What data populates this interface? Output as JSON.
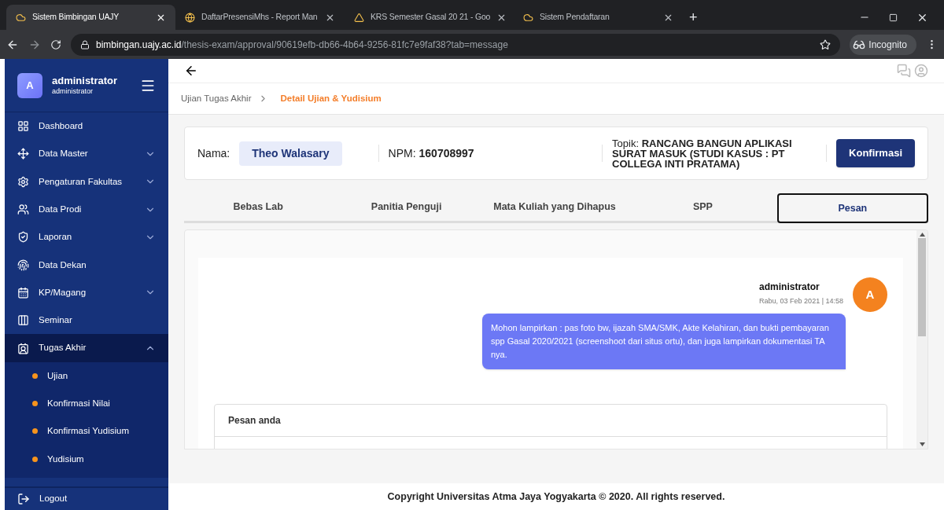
{
  "browser": {
    "tabs": [
      {
        "title": "Sistem Bimbingan UAJY",
        "selected": true
      },
      {
        "title": "DaftarPresensiMhs - Report Man",
        "selected": false
      },
      {
        "title": "KRS Semester Gasal 20 21 - Goo",
        "selected": false
      },
      {
        "title": "Sistem Pendaftaran",
        "selected": false
      }
    ],
    "new_tab": "+",
    "url_host": "bimbingan.uajy.ac.id",
    "url_path": "/thesis-exam/approval/90619efb-db66-4b64-9256-81fc7e9faf38?tab=message",
    "profile": "Incognito"
  },
  "sidebar": {
    "avatar": "A",
    "user_name": "administrator",
    "user_role": "administrator",
    "items": [
      {
        "label": "Dashboard",
        "kind": "link"
      },
      {
        "label": "Data Master",
        "kind": "menu",
        "expanded": false
      },
      {
        "label": "Pengaturan Fakultas",
        "kind": "menu",
        "expanded": false
      },
      {
        "label": "Data Prodi",
        "kind": "menu",
        "expanded": false
      },
      {
        "label": "Laporan",
        "kind": "menu",
        "expanded": false
      },
      {
        "label": "Data Dekan",
        "kind": "link"
      },
      {
        "label": "KP/Magang",
        "kind": "menu",
        "expanded": false
      },
      {
        "label": "Seminar",
        "kind": "link"
      },
      {
        "label": "Tugas Akhir",
        "kind": "menu",
        "expanded": true,
        "children": [
          {
            "label": "Ujian"
          },
          {
            "label": "Konfirmasi Nilai"
          },
          {
            "label": "Konfirmasi Yudisium"
          },
          {
            "label": "Yudisium"
          }
        ]
      }
    ],
    "logout": "Logout"
  },
  "breadcrumb": [
    {
      "label": "Ujian Tugas Akhir",
      "selected": false
    },
    {
      "label": "Detail Ujian & Yudisium",
      "selected": true
    }
  ],
  "summary": {
    "name_label": "Nama:",
    "name": "Theo Walasary",
    "npm_label": "NPM:",
    "npm": "160708997",
    "topic_label": "Topik:",
    "topic": "RANCANG BANGUN APLIKASI SURAT MASUK (STUDI KASUS : PT COLLEGA INTI PRATAMA)",
    "confirm_button": "Konfirmasi"
  },
  "tabs": [
    {
      "label": "Bebas Lab",
      "selected": false
    },
    {
      "label": "Panitia Penguji",
      "selected": false
    },
    {
      "label": "Mata Kuliah yang Dihapus",
      "selected": false
    },
    {
      "label": "SPP",
      "selected": false
    },
    {
      "label": "Pesan",
      "selected": true
    }
  ],
  "messages": [
    {
      "sender": "administrator",
      "avatar": "A",
      "time": "Rabu, 03 Feb 2021 | 14:58",
      "text": "Mohon lampirkan : pas foto bw, ijazah SMA/SMK, Akte Kelahiran, dan bukti pembayaran spp Gasal 2020/2021 (screenshoot dari situs ortu), dan juga lampirkan dokumentasi TA nya."
    }
  ],
  "compose": {
    "title": "Pesan anda"
  },
  "footer": "Copyright Universitas Atma Jaya Yogyakarta © 2020. All rights reserved."
}
